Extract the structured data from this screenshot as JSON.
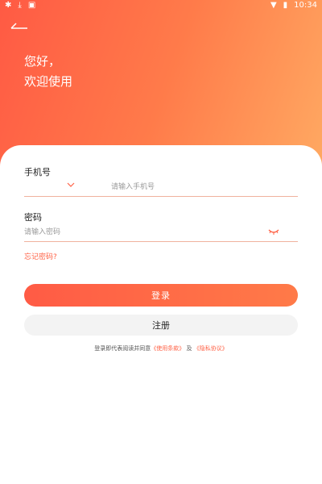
{
  "status_bar": {
    "left_icons": [
      "app-icon",
      "download-icon",
      "a-icon"
    ],
    "time": "10:34"
  },
  "greeting": {
    "line1": "您好，",
    "line2": "欢迎使用"
  },
  "form": {
    "phone_label": "手机号",
    "phone_placeholder": "请输入手机号",
    "password_label": "密码",
    "password_placeholder": "请输入密码",
    "forgot_link": "忘记密码?"
  },
  "buttons": {
    "login": "登录",
    "register": "注册"
  },
  "agreement": {
    "prefix": "登录即代表阅读并同意",
    "terms": "《使用条款》",
    "and": "及",
    "privacy": "《隐私协议》"
  },
  "colors": {
    "accent": "#ff6246",
    "gradient_start": "#ff5a44",
    "gradient_end": "#ffab63"
  }
}
